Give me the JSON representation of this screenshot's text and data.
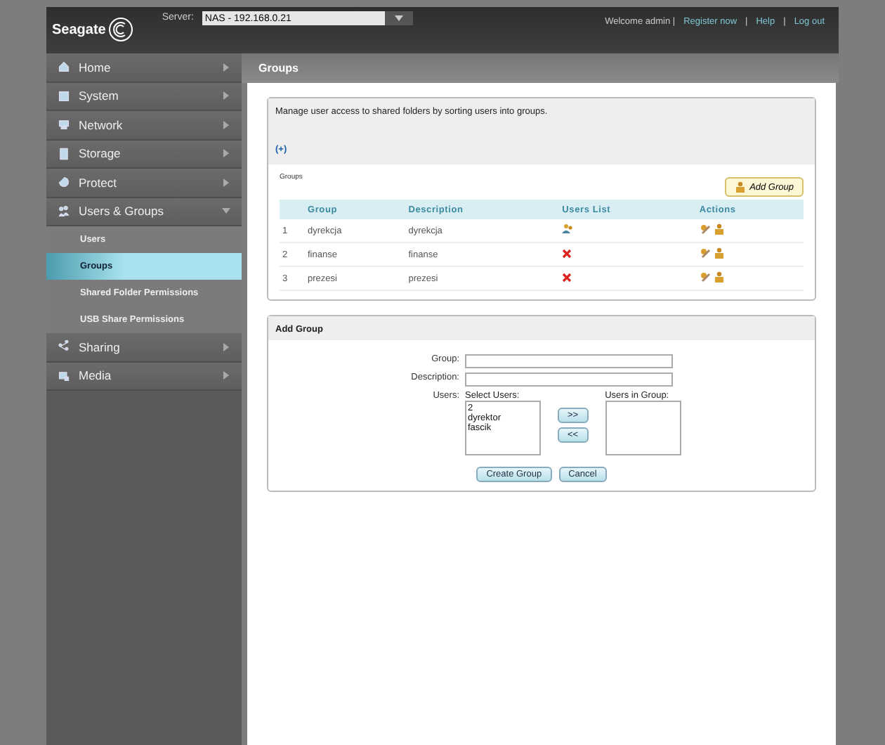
{
  "header": {
    "logo": "Seagate",
    "server_label": "Server:",
    "server_value": "NAS - 192.168.0.21",
    "welcome": "Welcome admin |",
    "links": [
      "Register now",
      "Help",
      "Log out"
    ],
    "separators": [
      "|",
      "|"
    ]
  },
  "sidebar": {
    "items": [
      {
        "label": "Home",
        "expanded": false
      },
      {
        "label": "System",
        "expanded": false
      },
      {
        "label": "Network",
        "expanded": false
      },
      {
        "label": "Storage",
        "expanded": false
      },
      {
        "label": "Protect",
        "expanded": false
      },
      {
        "label": "Users & Groups",
        "expanded": true,
        "children": [
          {
            "label": "Users",
            "selected": false
          },
          {
            "label": "Groups",
            "selected": true
          },
          {
            "label": "Shared Folder Permissions",
            "selected": false
          },
          {
            "label": "USB Share Permissions",
            "selected": false
          }
        ]
      },
      {
        "label": "Sharing",
        "expanded": false
      },
      {
        "label": "Media",
        "expanded": false
      }
    ]
  },
  "page_title": "Groups",
  "intro": {
    "text": "Manage user access to shared folders by sorting users into groups.",
    "more": "(+)"
  },
  "groups_table": {
    "caption": "Groups",
    "add_button": "Add Group",
    "columns": [
      "Group",
      "Description",
      "Users List",
      "Actions"
    ],
    "rows": [
      {
        "index": "1",
        "group": "dyrekcja",
        "description": "dyrekcja",
        "has_users": true
      },
      {
        "index": "2",
        "group": "finanse",
        "description": "finanse",
        "has_users": false
      },
      {
        "index": "3",
        "group": "prezesi",
        "description": "prezesi",
        "has_users": false
      }
    ]
  },
  "add_group": {
    "title": "Add Group",
    "group_label": "Group:",
    "description_label": "Description:",
    "users_label": "Users:",
    "select_users_label": "Select Users:",
    "select_users": [
      "2",
      "dyrektor",
      "fascik"
    ],
    "users_in_group_label": "Users in Group:",
    "add_arrow": ">>",
    "remove_arrow": "<<",
    "create_button": "Create Group",
    "cancel_button": "Cancel"
  }
}
